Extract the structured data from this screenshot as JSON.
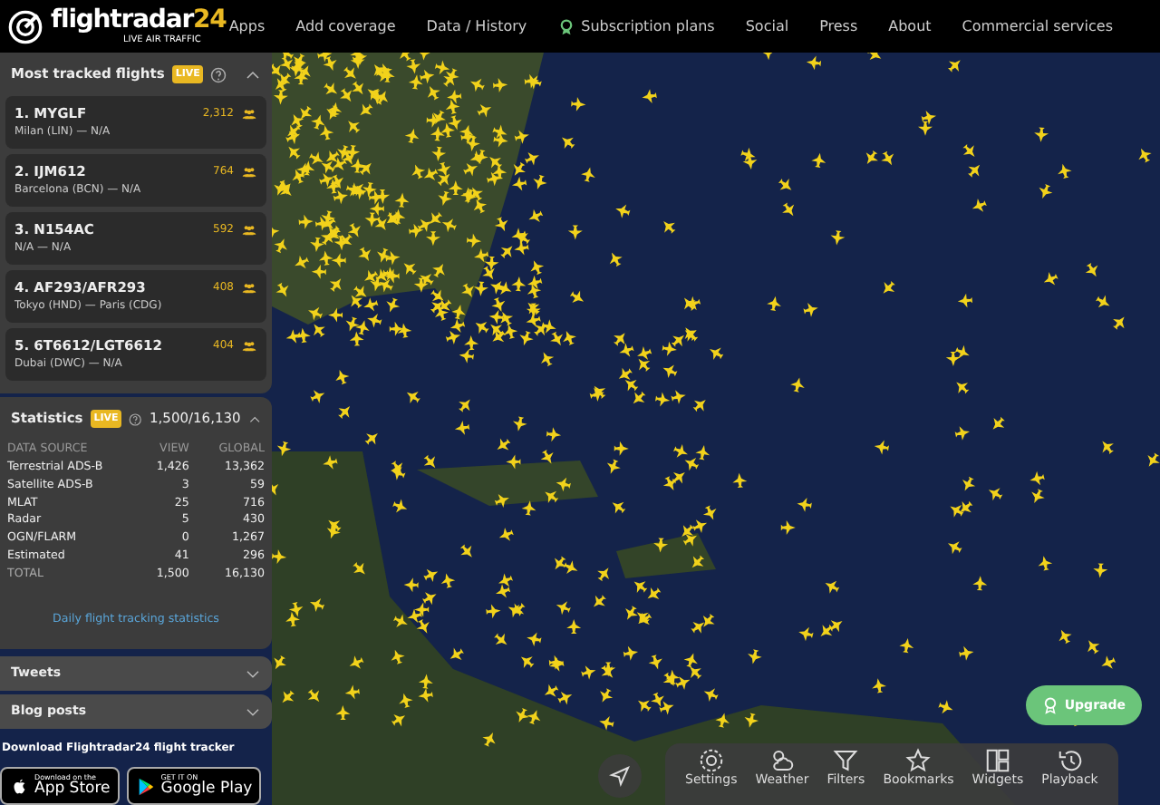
{
  "logo": {
    "name": "flightradar",
    "number": "24",
    "tagline": "LIVE AIR TRAFFIC"
  },
  "nav": [
    {
      "label": "Apps",
      "kind": "plain"
    },
    {
      "label": "Add coverage",
      "kind": "plain"
    },
    {
      "label": "Data / History",
      "kind": "plain"
    },
    {
      "label": "Subscription plans",
      "kind": "badge"
    },
    {
      "label": "Social",
      "kind": "plain"
    },
    {
      "label": "Press",
      "kind": "plain"
    },
    {
      "label": "About",
      "kind": "plain"
    },
    {
      "label": "Commercial services",
      "kind": "plain"
    }
  ],
  "most_tracked": {
    "title": "Most tracked flights",
    "live": "LIVE",
    "expanded": true,
    "flights": [
      {
        "flight": "1. MYGLF",
        "route": "Milan (LIN) — N/A",
        "count": "2,312"
      },
      {
        "flight": "2. IJM612",
        "route": "Barcelona (BCN) — N/A",
        "count": "764"
      },
      {
        "flight": "3. N154AC",
        "route": "N/A — N/A",
        "count": "592"
      },
      {
        "flight": "4. AF293/AFR293",
        "route": "Tokyo (HND) — Paris (CDG)",
        "count": "408"
      },
      {
        "flight": "5. 6T6612/LGT6612",
        "route": "Dubai (DWC) — N/A",
        "count": "404"
      }
    ]
  },
  "statistics": {
    "title": "Statistics",
    "live": "LIVE",
    "summary": "1,500/16,130",
    "expanded": true,
    "columns": [
      "DATA SOURCE",
      "VIEW",
      "GLOBAL"
    ],
    "rows": [
      {
        "source": "Terrestrial ADS-B",
        "view": "1,426",
        "global": "13,362",
        "kind": "data"
      },
      {
        "source": "Satellite ADS-B",
        "view": "3",
        "global": "59",
        "kind": "data"
      },
      {
        "source": "MLAT",
        "view": "25",
        "global": "716",
        "kind": "data"
      },
      {
        "source": "Radar",
        "view": "5",
        "global": "430",
        "kind": "data"
      },
      {
        "source": "OGN/FLARM",
        "view": "0",
        "global": "1,267",
        "kind": "data"
      },
      {
        "source": "Estimated",
        "view": "41",
        "global": "296",
        "kind": "data"
      },
      {
        "source": "TOTAL",
        "view": "1,500",
        "global": "16,130",
        "kind": "total"
      }
    ],
    "link": "Daily flight tracking statistics"
  },
  "collapsed_panels": [
    {
      "title": "Tweets",
      "expanded": false
    },
    {
      "title": "Blog posts",
      "expanded": false
    }
  ],
  "download": {
    "title": "Download Flightradar24 flight tracker",
    "stores": [
      {
        "small": "Download on the",
        "big": "App Store",
        "kind": "apple"
      },
      {
        "small": "GET IT ON",
        "big": "Google Play",
        "kind": "google"
      }
    ]
  },
  "upgrade": "Upgrade",
  "toolbar": [
    {
      "label": "Settings",
      "kind": "settings"
    },
    {
      "label": "Weather",
      "kind": "weather"
    },
    {
      "label": "Filters",
      "kind": "filters"
    },
    {
      "label": "Bookmarks",
      "kind": "bookmarks"
    },
    {
      "label": "Widgets",
      "kind": "widgets"
    },
    {
      "label": "Playback",
      "kind": "playback"
    }
  ]
}
